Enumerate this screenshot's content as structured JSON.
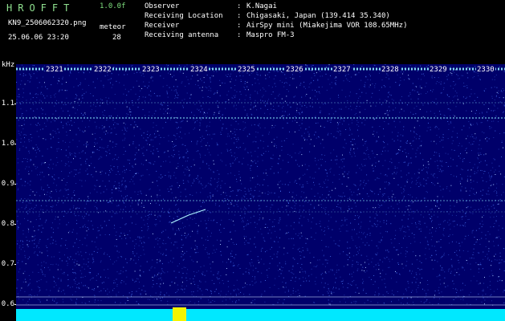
{
  "header": {
    "brand": "HROFFT",
    "version": "1.0.0f",
    "filename": "KN9_2506062320.png",
    "mode": "meteor",
    "datetime": "25.06.06 23:20",
    "count": "28",
    "info": [
      {
        "label": "Observer",
        "value": "K.Nagai"
      },
      {
        "label": "Receiving Location",
        "value": "Chigasaki, Japan (139.414 35.340)"
      },
      {
        "label": "Receiver",
        "value": "AirSpy mini (Miakejima VOR 108.65MHz)"
      },
      {
        "label": "Receiving antenna",
        "value": "Maspro FM-3"
      }
    ]
  },
  "axis": {
    "unit": "kHz",
    "y_labels": [
      "1.1",
      "1.0",
      "0.9",
      "0.8",
      "0.7",
      "0.6"
    ],
    "minute_labels": [
      "2321",
      "2322",
      "2323",
      "2324",
      "2325",
      "2326",
      "2327",
      "2328",
      "2329",
      "2330"
    ]
  },
  "colors": {
    "background": "#00006a",
    "noise": "#3a5cd8",
    "carrier": "#8ff0ff",
    "bottom_band": "#00e8ff",
    "burst": "#f4f400"
  }
}
